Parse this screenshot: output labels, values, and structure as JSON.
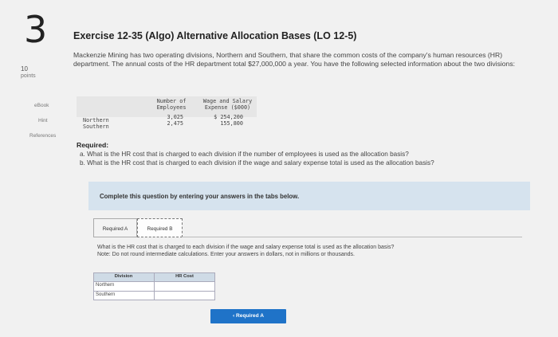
{
  "question_number": "3",
  "title": "Exercise 12-35 (Algo) Alternative Allocation Bases (LO 12-5)",
  "points": {
    "value": "10",
    "label": "points"
  },
  "sidebar": {
    "ebook": "eBook",
    "hint": "Hint",
    "references": "References"
  },
  "intro": "Mackenzie Mining has two operating divisions, Northern and Southern, that share the common costs of the company's human resources (HR) department. The annual costs of the HR department total $27,000,000 a year. You have the following selected information about the two divisions:",
  "data_table": {
    "headers": {
      "employees": [
        "Number of",
        "Employees"
      ],
      "wages": [
        "Wage and Salary",
        "Expense ($000)"
      ]
    },
    "rows": [
      {
        "name": "Northern",
        "employees": "3,025",
        "wages": "$ 254,200"
      },
      {
        "name": "Southern",
        "employees": "2,475",
        "wages": "155,800"
      }
    ]
  },
  "required": {
    "heading": "Required:",
    "a": "a. What is the HR cost that is charged to each division if the number of employees is used as the allocation basis?",
    "b": "b. What is the HR cost that is charged to each division if the wage and salary expense total is used as the allocation basis?"
  },
  "instructions_banner": "Complete this question by entering your answers in the tabs below.",
  "tabs": [
    "Required A",
    "Required B"
  ],
  "active_question": "What is the HR cost that is charged to each division if the wage and salary expense total is used as the allocation basis?",
  "active_note": "Note: Do not round intermediate calculations. Enter your answers in dollars, not in millions or thousands.",
  "answer_grid": {
    "headers": [
      "Division",
      "HR Cost"
    ],
    "rows": [
      {
        "division": "Northern",
        "value": ""
      },
      {
        "division": "Southern",
        "value": ""
      }
    ]
  },
  "nav_button": "‹  Required A"
}
